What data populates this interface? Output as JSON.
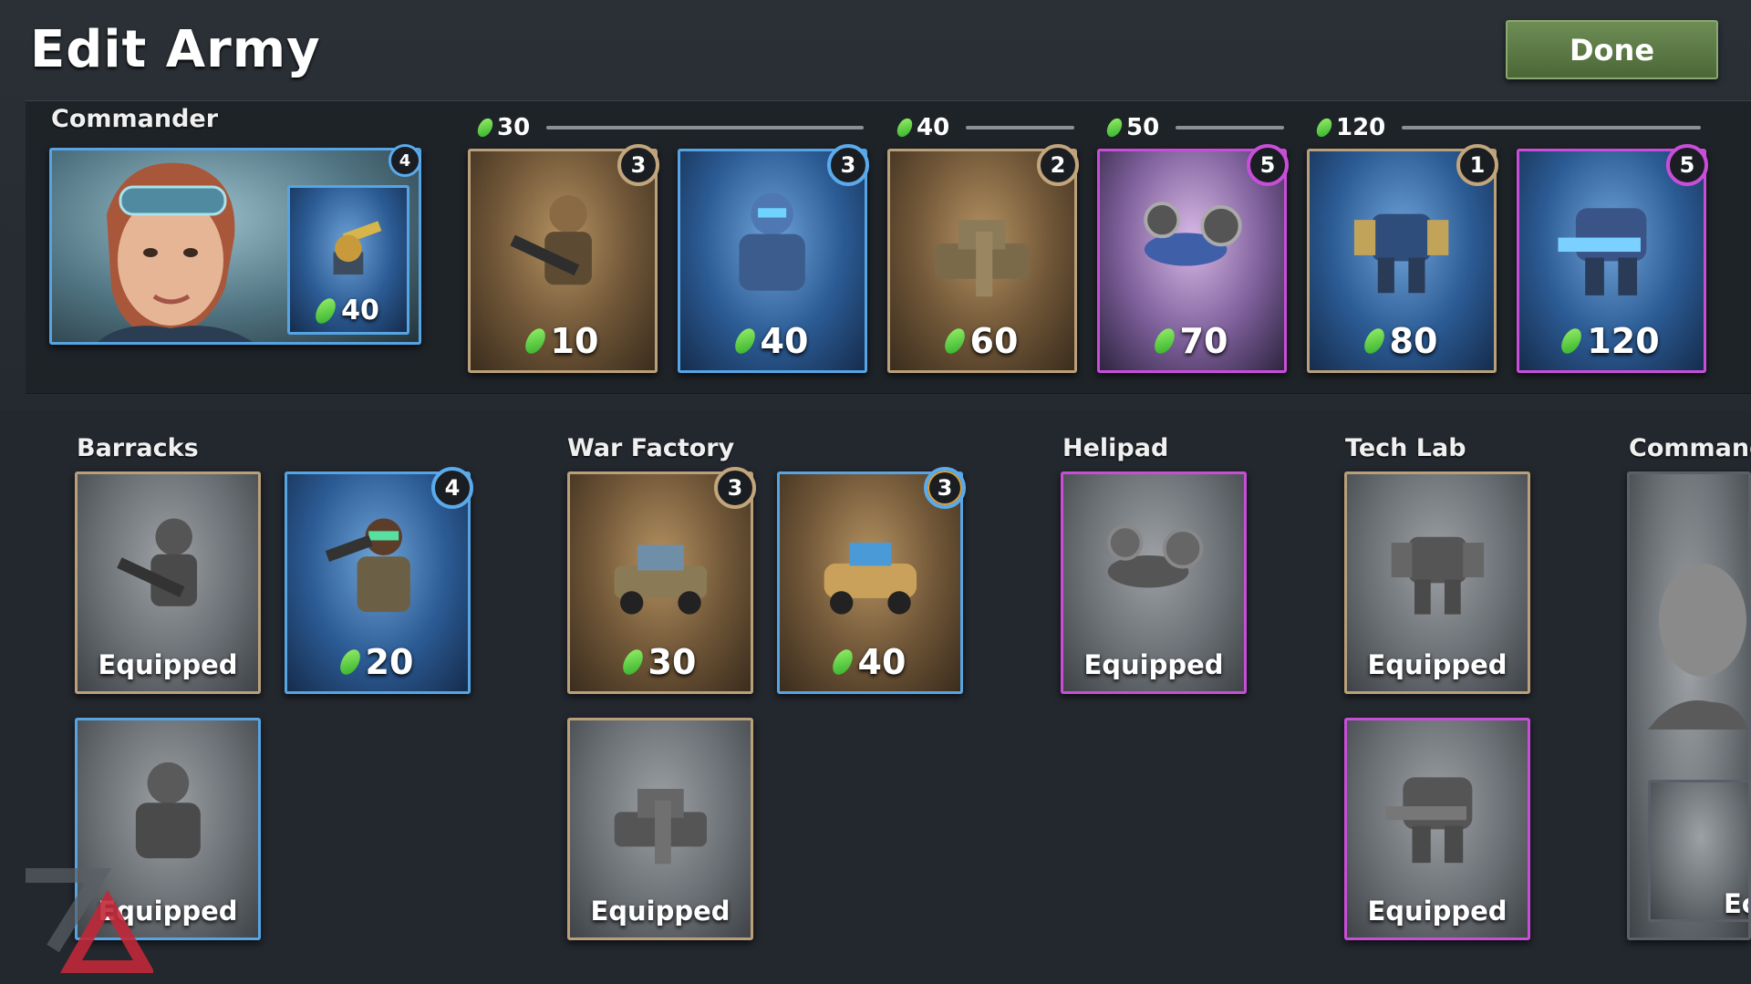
{
  "header": {
    "title": "Edit Army",
    "done_label": "Done"
  },
  "commander": {
    "label": "Commander",
    "portrait_icon": "commander-portrait",
    "ability": {
      "icon": "turret-icon",
      "cost": "40",
      "level": "4",
      "rarity": "blue"
    }
  },
  "cost_groups": [
    {
      "value": "30"
    },
    {
      "value": "40"
    },
    {
      "value": "50"
    },
    {
      "value": "120"
    }
  ],
  "deck": [
    {
      "icon": "rifleman-icon",
      "cost": "10",
      "level": "3",
      "rarity": "brown"
    },
    {
      "icon": "armored-trooper-icon",
      "cost": "40",
      "level": "3",
      "rarity": "blue"
    },
    {
      "icon": "tank-icon",
      "cost": "60",
      "level": "2",
      "rarity": "brown"
    },
    {
      "icon": "gunship-icon",
      "cost": "70",
      "level": "5",
      "rarity": "purple"
    },
    {
      "icon": "mech-icon",
      "cost": "80",
      "level": "1",
      "rarity": "brown"
    },
    {
      "icon": "heavy-mech-icon",
      "cost": "120",
      "level": "5",
      "rarity": "purple"
    }
  ],
  "sections": {
    "barracks": {
      "label": "Barracks",
      "cards": [
        {
          "icon": "rifleman-icon",
          "status": "Equipped",
          "rarity": "brown"
        },
        {
          "icon": "goggles-trooper-icon",
          "cost": "20",
          "level": "4",
          "rarity": "blue"
        },
        {
          "icon": "armored-trooper-icon",
          "status": "Equipped",
          "rarity": "blue"
        }
      ]
    },
    "war_factory": {
      "label": "War Factory",
      "cards": [
        {
          "icon": "jeep-icon",
          "cost": "30",
          "level": "3",
          "rarity": "brown"
        },
        {
          "icon": "buggy-icon",
          "cost": "40",
          "level": "3",
          "rarity": "blue"
        },
        {
          "icon": "tank-icon",
          "status": "Equipped",
          "rarity": "brown"
        }
      ]
    },
    "helipad": {
      "label": "Helipad",
      "cards": [
        {
          "icon": "gunship-icon",
          "status": "Equipped",
          "rarity": "purple"
        }
      ]
    },
    "tech_lab": {
      "label": "Tech Lab",
      "cards": [
        {
          "icon": "mech-icon",
          "status": "Equipped",
          "rarity": "brown"
        },
        {
          "icon": "heavy-mech-icon",
          "status": "Equipped",
          "rarity": "purple"
        }
      ]
    },
    "commander": {
      "label": "Commande",
      "cards": [
        {
          "icon": "commander-portrait",
          "status": "Ec",
          "rarity": "grey"
        }
      ]
    }
  },
  "colors": {
    "rarity_brown": "#b9a07a",
    "rarity_blue": "#56a4e4",
    "rarity_purple": "#c84ed8",
    "done_button": "#5a7a45",
    "gem": "#3fc13a"
  }
}
